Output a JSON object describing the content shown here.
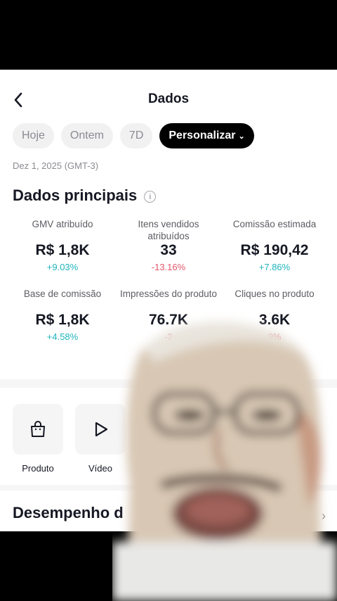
{
  "header": {
    "title": "Dados",
    "back_icon": "chevron-left-icon"
  },
  "filters": [
    {
      "label": "Hoje",
      "active": false
    },
    {
      "label": "Ontem",
      "active": false
    },
    {
      "label": "7D",
      "active": false
    },
    {
      "label": "Personalizar",
      "active": true,
      "caret": "⌄"
    }
  ],
  "date_range": "Dez 1, 2025 (GMT-3)",
  "main_data": {
    "title": "Dados principais",
    "info_icon": "info-icon",
    "metrics": [
      {
        "label": "GMV atribuído",
        "value": "R$ 1,8K",
        "change": "+9.03%",
        "trend": "positive"
      },
      {
        "label": "Itens vendidos atribuídos",
        "value": "33",
        "change": "-13.16%",
        "trend": "negative"
      },
      {
        "label": "Comissão estimada",
        "value": "R$ 190,42",
        "change": "+7.86%",
        "trend": "positive"
      },
      {
        "label": "Base de comissão",
        "value": "R$ 1,8K",
        "change": "+4.58%",
        "trend": "positive"
      },
      {
        "label": "Impressões do produto",
        "value": "76.7K",
        "change": "-2",
        "trend": "negative"
      },
      {
        "label": "Cliques no produto",
        "value": "3.6K",
        "change": "9%",
        "trend": "negative"
      }
    ]
  },
  "tools": [
    {
      "label": "Produto",
      "icon": "shopping-bag-icon"
    },
    {
      "label": "Vídeo",
      "icon": "play-icon"
    }
  ],
  "performance": {
    "title": "Desempenho d"
  },
  "colors": {
    "positive": "#1fb4bd",
    "negative": "#e0566b",
    "active_chip": "#000000"
  }
}
